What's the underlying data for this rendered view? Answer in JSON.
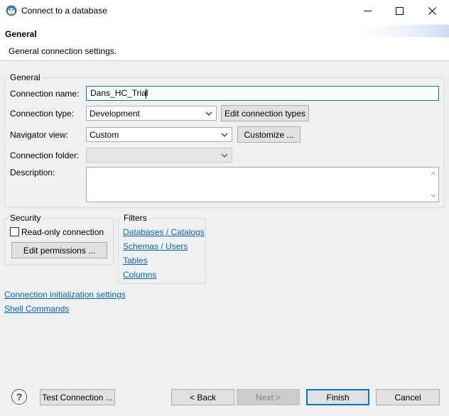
{
  "window": {
    "title": "Connect to a database"
  },
  "header": {
    "title": "General",
    "description": "General connection settings."
  },
  "general": {
    "legend": "General",
    "connection_name_label": "Connection name:",
    "connection_name_value": "Dans_HC_Trial",
    "connection_type_label": "Connection type:",
    "connection_type_value": "Development",
    "edit_connection_types": "Edit connection types",
    "navigator_view_label": "Navigator view:",
    "navigator_view_value": "Custom",
    "customize": "Customize ...",
    "connection_folder_label": "Connection folder:",
    "connection_folder_value": "",
    "description_label": "Description:",
    "description_value": ""
  },
  "security": {
    "legend": "Security",
    "read_only_label": "Read-only connection",
    "read_only_checked": false,
    "edit_permissions": "Edit permissions ..."
  },
  "filters": {
    "legend": "Filters",
    "items": [
      "Databases / Catalogs",
      "Schemas / Users",
      "Tables",
      "Columns"
    ]
  },
  "links": {
    "init_settings": "Connection initialization settings",
    "shell_commands": "Shell Commands"
  },
  "footer": {
    "help_glyph": "?",
    "test_connection": "Test Connection ...",
    "back": "< Back",
    "next": "Next >",
    "finish": "Finish",
    "cancel": "Cancel"
  }
}
